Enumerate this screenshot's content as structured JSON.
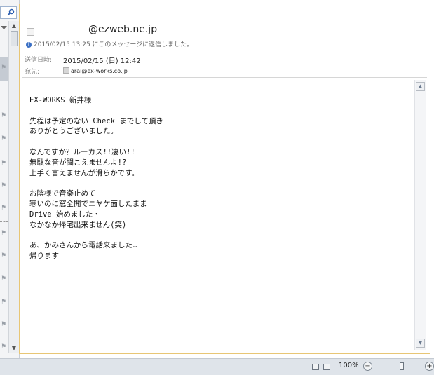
{
  "email": {
    "sender": "@ezweb.ne.jp",
    "info": "2015/02/15 13:25 にこのメッセージに返信しました。",
    "sent_label": "送信日時:",
    "sent_value": "2015/02/15 (日) 12:42",
    "to_label": "宛先:",
    "to_value": "arai@ex-works.co.jp",
    "body_lines": [
      "EX-WORKS 新井様",
      "",
      "先程は予定のない Check までして頂き",
      "ありがとうございました。",
      "",
      "なんですか？ルーカス!!凄い!!",
      "無駄な音が聞こえませんよ!?",
      "上手く言えませんが滑らかです。",
      "",
      "お陰様で音楽止めて",
      "寒いのに窓全開でニヤケ面したまま",
      "Drive 始めました・",
      "なかなか帰宅出来ません(笑)",
      "",
      "あ、かみさんから電話来ました…",
      "帰ります"
    ]
  },
  "statusbar": {
    "zoom": "100%",
    "zoom_out": "−",
    "zoom_in": "+",
    "zoom_level": 0.5
  },
  "icons": {
    "search": "search-icon",
    "info": "info-icon",
    "flag": "flag-icon",
    "contact": "contact-icon"
  },
  "colors": {
    "pane_border": "#e8c675",
    "info_icon": "#3a6fc4",
    "statusbar": "#dfe4ea"
  }
}
